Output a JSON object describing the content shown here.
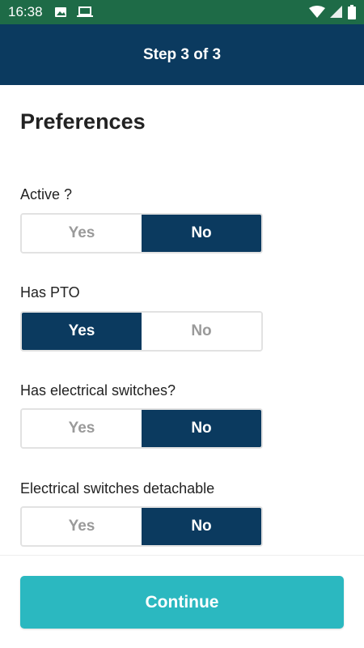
{
  "status_bar": {
    "time": "16:38",
    "left_icons": [
      "image-icon",
      "laptop-icon"
    ],
    "right_icons": [
      "wifi-icon",
      "signal-icon",
      "battery-icon"
    ],
    "color": "#1e6b47"
  },
  "header": {
    "title": "Step 3 of 3",
    "color": "#0b3a5f"
  },
  "main": {
    "title": "Preferences",
    "questions": [
      {
        "label": "Active ?",
        "yes": "Yes",
        "no": "No",
        "selected": "No"
      },
      {
        "label": "Has PTO",
        "yes": "Yes",
        "no": "No",
        "selected": "Yes"
      },
      {
        "label": "Has electrical switches?",
        "yes": "Yes",
        "no": "No",
        "selected": "No"
      },
      {
        "label": "Electrical switches detachable",
        "yes": "Yes",
        "no": "No",
        "selected": "No"
      }
    ]
  },
  "footer": {
    "continue_label": "Continue",
    "button_color": "#2bb8c0"
  }
}
